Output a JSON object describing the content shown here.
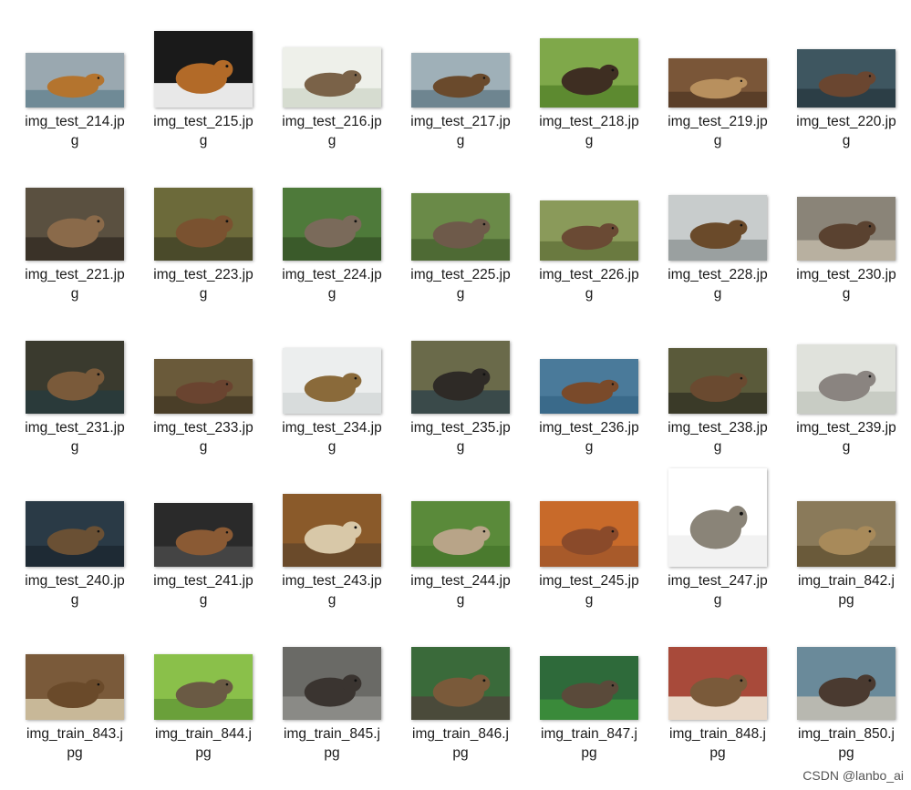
{
  "files": [
    {
      "name": "img_test_214.jpg",
      "name_l1": "img_test_214.jp",
      "name_l2": "g",
      "thumb": {
        "w": 108,
        "h": 60,
        "bg": "#9aa8b0",
        "fg": "#b4742e",
        "ground": "#6f8a96"
      }
    },
    {
      "name": "img_test_215.jpg",
      "name_l1": "img_test_215.jp",
      "name_l2": "g",
      "thumb": {
        "w": 108,
        "h": 84,
        "bg": "#1a1a1a",
        "fg": "#b26a28",
        "ground": "#e8e8e8"
      }
    },
    {
      "name": "img_test_216.jpg",
      "name_l1": "img_test_216.jp",
      "name_l2": "g",
      "thumb": {
        "w": 108,
        "h": 66,
        "bg": "#eef0ea",
        "fg": "#7a6248",
        "ground": "#d6dcd0"
      }
    },
    {
      "name": "img_test_217.jpg",
      "name_l1": "img_test_217.jp",
      "name_l2": "g",
      "thumb": {
        "w": 108,
        "h": 60,
        "bg": "#9fb0b8",
        "fg": "#6a4a2c",
        "ground": "#6e8590"
      }
    },
    {
      "name": "img_test_218.jpg",
      "name_l1": "img_test_218.jp",
      "name_l2": "g",
      "thumb": {
        "w": 108,
        "h": 76,
        "bg": "#7fa84a",
        "fg": "#3e2e22",
        "ground": "#5d8a30"
      }
    },
    {
      "name": "img_test_219.jpg",
      "name_l1": "img_test_219.jp",
      "name_l2": "g",
      "thumb": {
        "w": 108,
        "h": 54,
        "bg": "#7a5638",
        "fg": "#b8905e",
        "ground": "#5a3e28"
      }
    },
    {
      "name": "img_test_220.jpg",
      "name_l1": "img_test_220.jp",
      "name_l2": "g",
      "thumb": {
        "w": 108,
        "h": 64,
        "bg": "#3e5660",
        "fg": "#6a4630",
        "ground": "#2c3e46"
      }
    },
    {
      "name": "img_test_221.jpg",
      "name_l1": "img_test_221.jp",
      "name_l2": "g",
      "thumb": {
        "w": 108,
        "h": 80,
        "bg": "#5a5040",
        "fg": "#8a6a4a",
        "ground": "#3a3228"
      }
    },
    {
      "name": "img_test_223.jpg",
      "name_l1": "img_test_223.jp",
      "name_l2": "g",
      "thumb": {
        "w": 108,
        "h": 80,
        "bg": "#6c6a3a",
        "fg": "#7a5230",
        "ground": "#4a4a2a"
      }
    },
    {
      "name": "img_test_224.jpg",
      "name_l1": "img_test_224.jp",
      "name_l2": "g",
      "thumb": {
        "w": 108,
        "h": 80,
        "bg": "#4e7a3a",
        "fg": "#7a6a5a",
        "ground": "#3a5a2a"
      }
    },
    {
      "name": "img_test_225.jpg",
      "name_l1": "img_test_225.jp",
      "name_l2": "g",
      "thumb": {
        "w": 108,
        "h": 74,
        "bg": "#6a8a48",
        "fg": "#6e5a4a",
        "ground": "#4e6a34"
      }
    },
    {
      "name": "img_test_226.jpg",
      "name_l1": "img_test_226.jp",
      "name_l2": "g",
      "thumb": {
        "w": 108,
        "h": 66,
        "bg": "#8a9a5a",
        "fg": "#6a4a34",
        "ground": "#6a7a40"
      }
    },
    {
      "name": "img_test_228.jpg",
      "name_l1": "img_test_228.jp",
      "name_l2": "g",
      "thumb": {
        "w": 108,
        "h": 72,
        "bg": "#c8cccc",
        "fg": "#6a4a2a",
        "ground": "#9aa0a0"
      }
    },
    {
      "name": "img_test_230.jpg",
      "name_l1": "img_test_230.jp",
      "name_l2": "g",
      "thumb": {
        "w": 108,
        "h": 70,
        "bg": "#8a8478",
        "fg": "#5a4230",
        "ground": "#b8b0a0"
      }
    },
    {
      "name": "img_test_231.jpg",
      "name_l1": "img_test_231.jp",
      "name_l2": "g",
      "thumb": {
        "w": 108,
        "h": 80,
        "bg": "#3a3a2e",
        "fg": "#7a5a3a",
        "ground": "#2a3a3a"
      }
    },
    {
      "name": "img_test_233.jpg",
      "name_l1": "img_test_233.jp",
      "name_l2": "g",
      "thumb": {
        "w": 108,
        "h": 60,
        "bg": "#6a5a3a",
        "fg": "#6a4430",
        "ground": "#4a3e28"
      }
    },
    {
      "name": "img_test_234.jpg",
      "name_l1": "img_test_234.jp",
      "name_l2": "g",
      "thumb": {
        "w": 108,
        "h": 72,
        "bg": "#eceeee",
        "fg": "#8a6a3a",
        "ground": "#d8dcdc"
      }
    },
    {
      "name": "img_test_235.jpg",
      "name_l1": "img_test_235.jp",
      "name_l2": "g",
      "thumb": {
        "w": 108,
        "h": 80,
        "bg": "#6a6a4a",
        "fg": "#2e2a26",
        "ground": "#3a4a4a"
      }
    },
    {
      "name": "img_test_236.jpg",
      "name_l1": "img_test_236.jp",
      "name_l2": "g",
      "thumb": {
        "w": 108,
        "h": 60,
        "bg": "#4a7a9a",
        "fg": "#7a4a2a",
        "ground": "#3a6a8a"
      }
    },
    {
      "name": "img_test_238.jpg",
      "name_l1": "img_test_238.jp",
      "name_l2": "g",
      "thumb": {
        "w": 108,
        "h": 72,
        "bg": "#5a5a3a",
        "fg": "#6a4a30",
        "ground": "#3a3a28"
      }
    },
    {
      "name": "img_test_239.jpg",
      "name_l1": "img_test_239.jp",
      "name_l2": "g",
      "thumb": {
        "w": 108,
        "h": 76,
        "bg": "#e0e2dc",
        "fg": "#8a8480",
        "ground": "#c8ccc4"
      }
    },
    {
      "name": "img_test_240.jpg",
      "name_l1": "img_test_240.jp",
      "name_l2": "g",
      "thumb": {
        "w": 108,
        "h": 72,
        "bg": "#2a3a46",
        "fg": "#6a5034",
        "ground": "#1e2a34"
      }
    },
    {
      "name": "img_test_241.jpg",
      "name_l1": "img_test_241.jp",
      "name_l2": "g",
      "thumb": {
        "w": 108,
        "h": 70,
        "bg": "#2a2a2a",
        "fg": "#8a5a34",
        "ground": "#444444"
      }
    },
    {
      "name": "img_test_243.jpg",
      "name_l1": "img_test_243.jp",
      "name_l2": "g",
      "thumb": {
        "w": 108,
        "h": 80,
        "bg": "#8a5a2a",
        "fg": "#d8c8a8",
        "ground": "#6a4a2a"
      }
    },
    {
      "name": "img_test_244.jpg",
      "name_l1": "img_test_244.jp",
      "name_l2": "g",
      "thumb": {
        "w": 108,
        "h": 72,
        "bg": "#5a8a3a",
        "fg": "#b8a488",
        "ground": "#4a7a2e"
      }
    },
    {
      "name": "img_test_245.jpg",
      "name_l1": "img_test_245.jp",
      "name_l2": "g",
      "thumb": {
        "w": 108,
        "h": 72,
        "bg": "#c86a2a",
        "fg": "#8a4a2a",
        "ground": "#a85a2a"
      }
    },
    {
      "name": "img_test_247.jpg",
      "name_l1": "img_test_247.jp",
      "name_l2": "g",
      "thumb": {
        "w": 108,
        "h": 108,
        "bg": "#ffffff",
        "fg": "#8a8478",
        "ground": "#f2f2f2"
      }
    },
    {
      "name": "img_train_842.jpg",
      "name_l1": "img_train_842.j",
      "name_l2": "pg",
      "thumb": {
        "w": 108,
        "h": 72,
        "bg": "#8a7a5a",
        "fg": "#a88a5a",
        "ground": "#6a5a3a"
      }
    },
    {
      "name": "img_train_843.jpg",
      "name_l1": "img_train_843.j",
      "name_l2": "pg",
      "thumb": {
        "w": 108,
        "h": 72,
        "bg": "#7a5a3a",
        "fg": "#6a4a2a",
        "ground": "#c8b898"
      }
    },
    {
      "name": "img_train_844.jpg",
      "name_l1": "img_train_844.j",
      "name_l2": "pg",
      "thumb": {
        "w": 108,
        "h": 72,
        "bg": "#8ac04a",
        "fg": "#6a5a44",
        "ground": "#6aa03a"
      }
    },
    {
      "name": "img_train_845.jpg",
      "name_l1": "img_train_845.j",
      "name_l2": "pg",
      "thumb": {
        "w": 108,
        "h": 80,
        "bg": "#6a6a66",
        "fg": "#3a3430",
        "ground": "#8a8a86"
      }
    },
    {
      "name": "img_train_846.jpg",
      "name_l1": "img_train_846.j",
      "name_l2": "pg",
      "thumb": {
        "w": 108,
        "h": 80,
        "bg": "#3a6a3a",
        "fg": "#7a5a3a",
        "ground": "#4a4a3a"
      }
    },
    {
      "name": "img_train_847.jpg",
      "name_l1": "img_train_847.j",
      "name_l2": "pg",
      "thumb": {
        "w": 108,
        "h": 70,
        "bg": "#2e6a3a",
        "fg": "#5a4a3a",
        "ground": "#3a8a3a"
      }
    },
    {
      "name": "img_train_848.jpg",
      "name_l1": "img_train_848.j",
      "name_l2": "pg",
      "thumb": {
        "w": 108,
        "h": 80,
        "bg": "#a84a3a",
        "fg": "#7a5a3a",
        "ground": "#e8d8c8"
      }
    },
    {
      "name": "img_train_850.jpg",
      "name_l1": "img_train_850.j",
      "name_l2": "pg",
      "thumb": {
        "w": 108,
        "h": 80,
        "bg": "#6a8a9a",
        "fg": "#4a3a30",
        "ground": "#b8b8b0"
      }
    }
  ],
  "watermark": "CSDN @lanbo_ai"
}
